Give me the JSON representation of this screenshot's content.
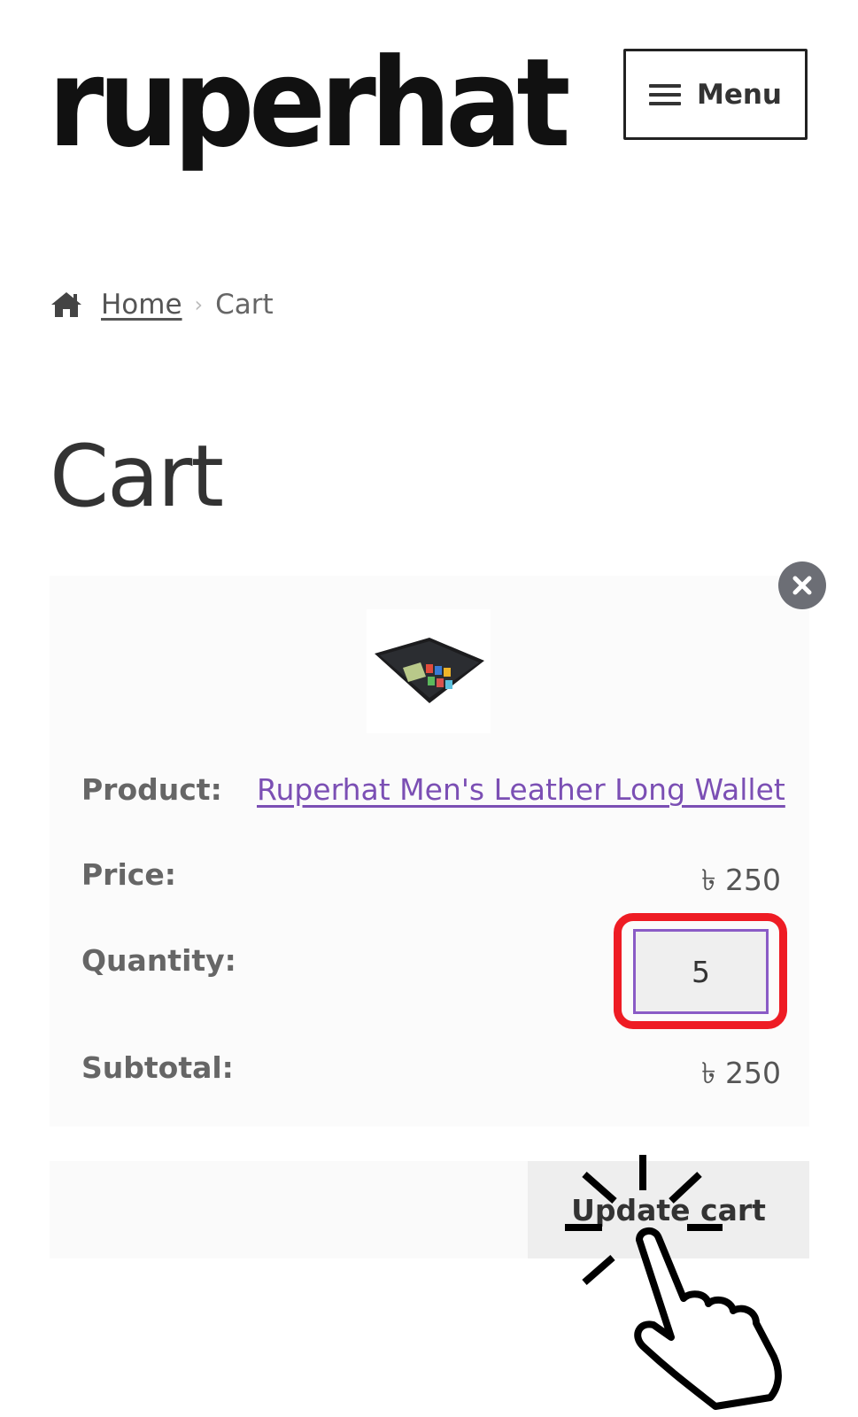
{
  "header": {
    "logo_text": "ruperhat",
    "menu_label": "Menu"
  },
  "breadcrumb": {
    "home": "Home",
    "current": "Cart"
  },
  "page_title": "Cart",
  "cart_item": {
    "labels": {
      "product": "Product:",
      "price": "Price:",
      "quantity": "Quantity:",
      "subtotal": "Subtotal:"
    },
    "product_name": "Ruperhat Men's Leather Long Wallet",
    "price": "৳ 250",
    "quantity": "5",
    "subtotal": "৳ 250"
  },
  "actions": {
    "update_cart_label": "Update cart"
  },
  "icons": {
    "home": "home-icon",
    "menu": "hamburger-icon",
    "remove": "close-circle-icon",
    "pointer": "tap-hand-icon"
  },
  "colors": {
    "link": "#7b4fb4",
    "highlight": "#ee1c24",
    "input_border": "#8a5bc6"
  }
}
